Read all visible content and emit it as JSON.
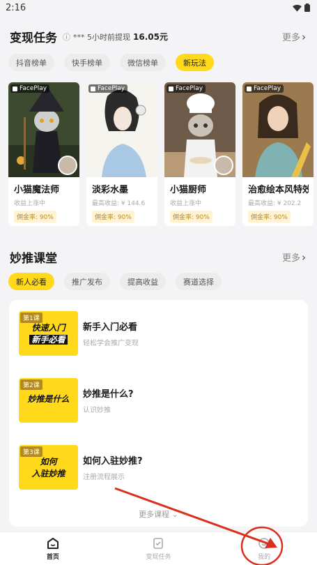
{
  "status": {
    "time": "2:16"
  },
  "earn": {
    "title": "变现任务",
    "ticker_user": "*** 5小时前提现",
    "ticker_amount": "16.05元",
    "more": "更多",
    "chips": [
      "抖音榜单",
      "快手榜单",
      "微信榜单",
      "新玩法"
    ],
    "active_chip": "新玩法",
    "badge": "FacePlay",
    "cards": [
      {
        "title": "小猫魔法师",
        "sub": "收益上涨中",
        "tag": "佣金率: 90%"
      },
      {
        "title": "淡彩水墨",
        "sub": "最高收益: ¥ 144.6",
        "tag": "佣金率: 90%"
      },
      {
        "title": "小猫厨师",
        "sub": "收益上涨中",
        "tag": "佣金率: 90%"
      },
      {
        "title": "治愈绘本风特效",
        "sub": "最高收益: ¥ 202.2",
        "tag": "佣金率: 90%"
      }
    ]
  },
  "classroom": {
    "title": "妙推课堂",
    "more": "更多",
    "chips": [
      "新人必看",
      "推广发布",
      "提高收益",
      "赛道选择"
    ],
    "active_chip": "新人必看",
    "lessons": [
      {
        "num": "第1课",
        "thumb_line1": "快速入门",
        "thumb_line2": "新手必看",
        "title": "新手入门必看",
        "desc": "轻松学会推广变现"
      },
      {
        "num": "第2课",
        "thumb_line1": "妙推是什么",
        "thumb_line2": "",
        "title": "妙推是什么?",
        "desc": "认识妙推"
      },
      {
        "num": "第3课",
        "thumb_line1": "如何",
        "thumb_line2": "入驻妙推",
        "title": "如何入驻妙推?",
        "desc": "注册流程展示"
      }
    ],
    "more_courses": "更多课程"
  },
  "tabs": [
    {
      "label": "首页",
      "icon": "home-icon"
    },
    {
      "label": "变现任务",
      "icon": "task-icon"
    },
    {
      "label": "我的",
      "icon": "profile-icon"
    }
  ],
  "colors": {
    "accent": "#ffd91a",
    "annotation": "#d9301e"
  }
}
